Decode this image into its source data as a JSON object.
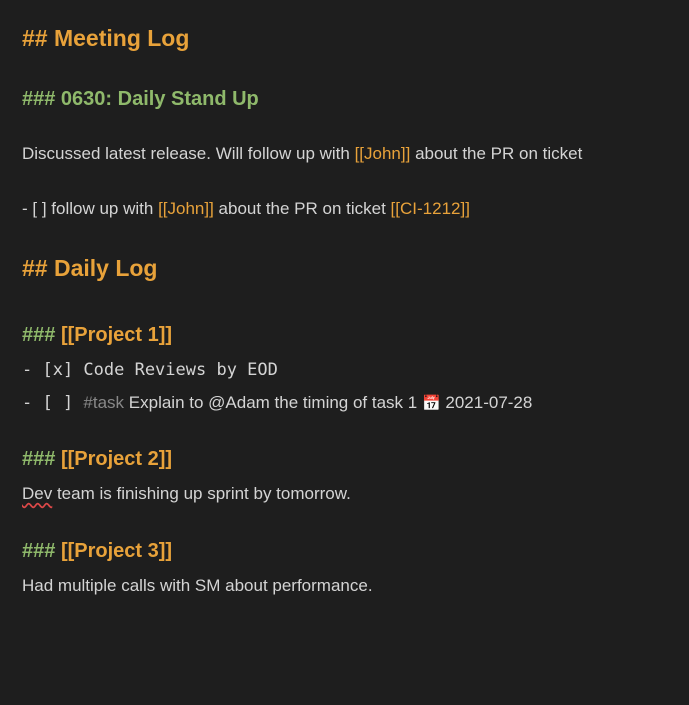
{
  "sections": {
    "meeting_log": {
      "h2": "## Meeting Log",
      "standup": {
        "h3": "### 0630: Daily Stand Up",
        "para_pre": "Discussed latest release.  Will follow up with ",
        "para_link1": "[[John]]",
        "para_post": " about the PR on ticket",
        "task": {
          "prefix": "- [   ] follow up with ",
          "link1": "[[John]]",
          "mid": " about the PR on ticket ",
          "link2": "[[CI-1212]]"
        }
      }
    },
    "daily_log": {
      "h2": "## Daily Log",
      "project1": {
        "h3_hashes": "### ",
        "h3_link": "[[Project 1]]",
        "line1": "- [x] Code Reviews by EOD",
        "line2": {
          "prefix": "- [   ] ",
          "tag": "#task",
          "text": " Explain to @Adam the timing of task 1 ",
          "emoji": "📅",
          "date": " 2021-07-28"
        }
      },
      "project2": {
        "h3_hashes": "### ",
        "h3_link": "[[Project 2]]",
        "text_pre": "Dev",
        "text_post": " team is finishing up sprint by tomorrow."
      },
      "project3": {
        "h3_hashes": "### ",
        "h3_link": "[[Project 3]]",
        "text": "Had multiple calls with SM about performance."
      }
    }
  }
}
